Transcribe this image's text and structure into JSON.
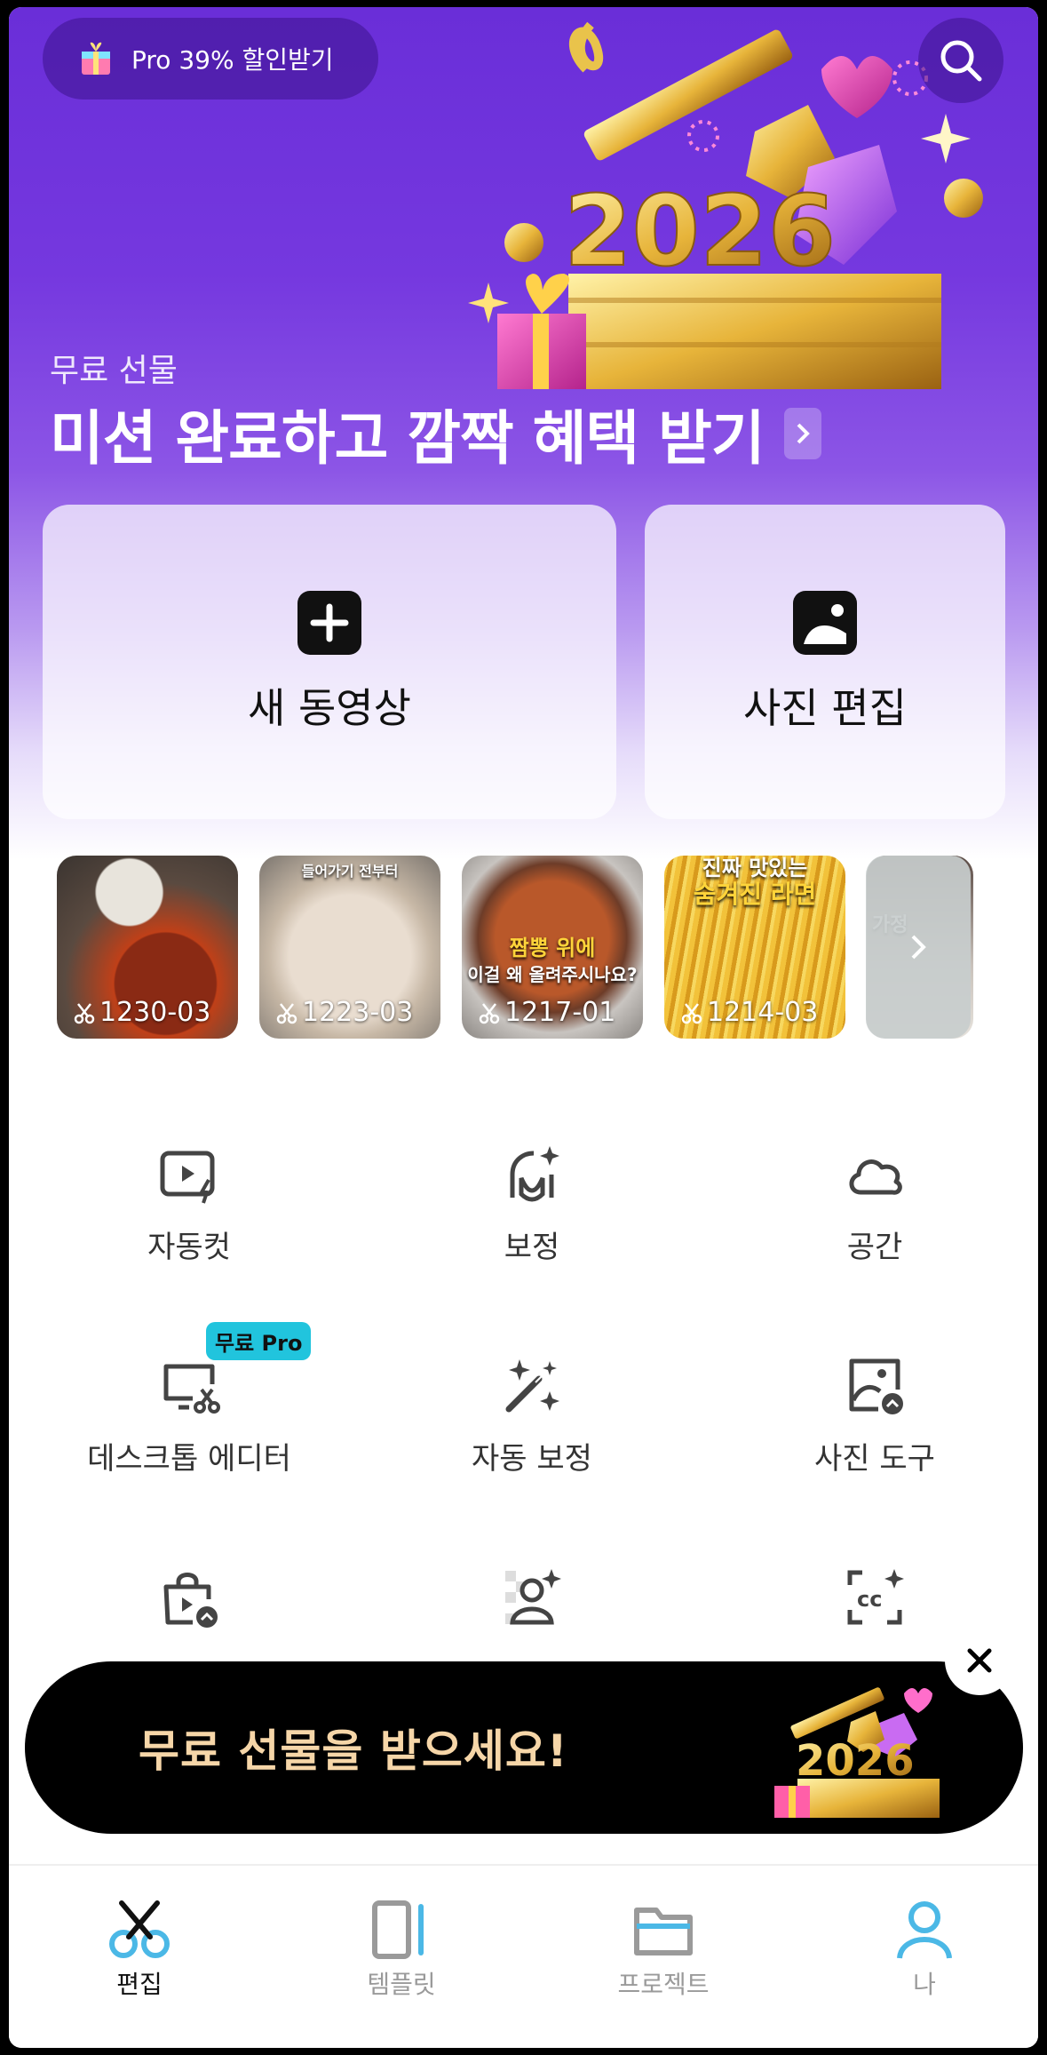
{
  "promo": {
    "text": "Pro 39% 할인받기"
  },
  "hero": {
    "subtitle": "무료 선물",
    "title": "미션 완료하고 깜짝 혜택 받기",
    "art_text": "2026"
  },
  "cards": [
    {
      "label": "새 동영상",
      "icon": "plus-icon"
    },
    {
      "label": "사진 편집",
      "icon": "image-icon"
    }
  ],
  "drafts": [
    {
      "label": "1230-03"
    },
    {
      "label": "1223-03",
      "caption": "들어가기 전부터"
    },
    {
      "label": "1217-01",
      "caption": "짬뽕 위에",
      "caption2": "이걸 왜 올려주시나요?"
    },
    {
      "label": "1214-03",
      "caption": "진짜 맛있는",
      "caption2": "숨겨진 라면"
    },
    {
      "label": "",
      "caption": "가정"
    }
  ],
  "tools": [
    {
      "label": "자동컷",
      "icon": "autocut-icon"
    },
    {
      "label": "보정",
      "icon": "retouch-icon"
    },
    {
      "label": "공간",
      "icon": "cloud-icon"
    },
    {
      "label": "데스크톱 에디터",
      "icon": "desktop-editor-icon",
      "badge": "무료 Pro"
    },
    {
      "label": "자동 보정",
      "icon": "magic-wand-icon"
    },
    {
      "label": "사진 도구",
      "icon": "photo-tools-icon"
    },
    {
      "label": "",
      "icon": "shopping-bag-icon"
    },
    {
      "label": "",
      "icon": "person-cutout-icon"
    },
    {
      "label": "",
      "icon": "auto-captions-icon"
    }
  ],
  "banner": {
    "text": "무료 선물을 받으세요!"
  },
  "tabs": [
    {
      "label": "편집",
      "icon": "scissors-icon",
      "active": true
    },
    {
      "label": "템플릿",
      "icon": "template-icon",
      "active": false
    },
    {
      "label": "프로젝트",
      "icon": "folder-icon",
      "active": false
    },
    {
      "label": "나",
      "icon": "profile-icon",
      "active": false
    }
  ],
  "colors": {
    "hero": "#6a2ed8",
    "badge": "#21c4dd",
    "banner_text": "#f6d6a8",
    "tab_accent": "#4bb8e6"
  }
}
